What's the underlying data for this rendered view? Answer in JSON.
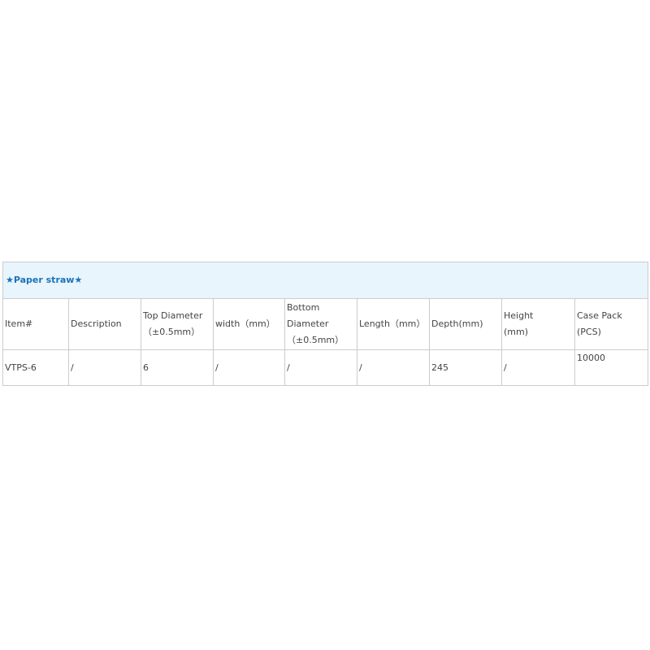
{
  "table": {
    "title": "★Paper straw★",
    "headers": [
      [
        "Item#"
      ],
      [
        "Description"
      ],
      [
        "Top Diameter",
        "（±0.5mm）"
      ],
      [
        "width（mm）"
      ],
      [
        "Bottom",
        "Diameter",
        "（±0.5mm）"
      ],
      [
        "Length（mm）"
      ],
      [
        "Depth(mm)"
      ],
      [
        "Height",
        "(mm)"
      ],
      [
        "Case Pack",
        "(PCS)"
      ]
    ],
    "rows": [
      [
        "VTPS-6",
        "/",
        "6",
        "/",
        "/",
        "/",
        "245",
        "/",
        "10000"
      ]
    ]
  }
}
